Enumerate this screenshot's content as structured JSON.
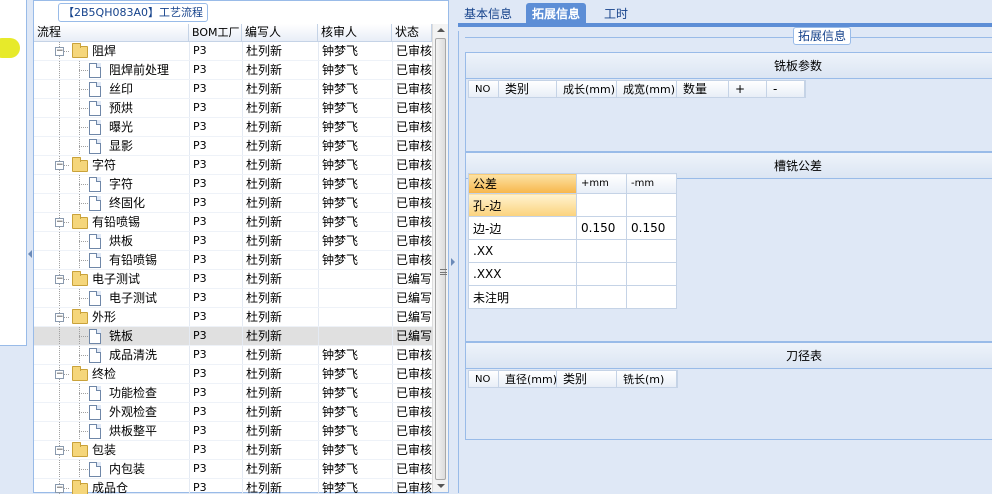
{
  "tree_panel": {
    "title": "【2B5QH083A0】工艺流程",
    "columns": [
      "流程",
      "BOM工厂",
      "编写人",
      "核审人",
      "状态"
    ],
    "rows": [
      {
        "level": 1,
        "type": "folder",
        "name": "阻焊",
        "bom": "P3",
        "writer": "杜列新",
        "reviewer": "钟梦飞",
        "status": "已审核"
      },
      {
        "level": 2,
        "type": "doc",
        "name": "阻焊前处理",
        "bom": "P3",
        "writer": "杜列新",
        "reviewer": "钟梦飞",
        "status": "已审核"
      },
      {
        "level": 2,
        "type": "doc",
        "name": "丝印",
        "bom": "P3",
        "writer": "杜列新",
        "reviewer": "钟梦飞",
        "status": "已审核"
      },
      {
        "level": 2,
        "type": "doc",
        "name": "预烘",
        "bom": "P3",
        "writer": "杜列新",
        "reviewer": "钟梦飞",
        "status": "已审核"
      },
      {
        "level": 2,
        "type": "doc",
        "name": "曝光",
        "bom": "P3",
        "writer": "杜列新",
        "reviewer": "钟梦飞",
        "status": "已审核"
      },
      {
        "level": 2,
        "type": "doc",
        "name": "显影",
        "bom": "P3",
        "writer": "杜列新",
        "reviewer": "钟梦飞",
        "status": "已审核"
      },
      {
        "level": 1,
        "type": "folder",
        "name": "字符",
        "bom": "P3",
        "writer": "杜列新",
        "reviewer": "钟梦飞",
        "status": "已审核"
      },
      {
        "level": 2,
        "type": "doc",
        "name": "字符",
        "bom": "P3",
        "writer": "杜列新",
        "reviewer": "钟梦飞",
        "status": "已审核"
      },
      {
        "level": 2,
        "type": "doc",
        "name": "终固化",
        "bom": "P3",
        "writer": "杜列新",
        "reviewer": "钟梦飞",
        "status": "已审核"
      },
      {
        "level": 1,
        "type": "folder",
        "name": "有铅喷锡",
        "bom": "P3",
        "writer": "杜列新",
        "reviewer": "钟梦飞",
        "status": "已审核"
      },
      {
        "level": 2,
        "type": "doc",
        "name": "烘板",
        "bom": "P3",
        "writer": "杜列新",
        "reviewer": "钟梦飞",
        "status": "已审核"
      },
      {
        "level": 2,
        "type": "doc",
        "name": "有铅喷锡",
        "bom": "P3",
        "writer": "杜列新",
        "reviewer": "钟梦飞",
        "status": "已审核"
      },
      {
        "level": 1,
        "type": "folder",
        "name": "电子测试",
        "bom": "P3",
        "writer": "杜列新",
        "reviewer": "",
        "status": "已编写"
      },
      {
        "level": 2,
        "type": "doc",
        "name": "电子测试",
        "bom": "P3",
        "writer": "杜列新",
        "reviewer": "",
        "status": "已编写"
      },
      {
        "level": 1,
        "type": "folder",
        "name": "外形",
        "bom": "P3",
        "writer": "杜列新",
        "reviewer": "",
        "status": "已编写"
      },
      {
        "level": 2,
        "type": "doc",
        "name": "铣板",
        "bom": "P3",
        "writer": "杜列新",
        "reviewer": "",
        "status": "已编写",
        "selected": true
      },
      {
        "level": 2,
        "type": "doc",
        "name": "成品清洗",
        "bom": "P3",
        "writer": "杜列新",
        "reviewer": "钟梦飞",
        "status": "已审核"
      },
      {
        "level": 1,
        "type": "folder",
        "name": "终检",
        "bom": "P3",
        "writer": "杜列新",
        "reviewer": "钟梦飞",
        "status": "已审核"
      },
      {
        "level": 2,
        "type": "doc",
        "name": "功能检查",
        "bom": "P3",
        "writer": "杜列新",
        "reviewer": "钟梦飞",
        "status": "已审核"
      },
      {
        "level": 2,
        "type": "doc",
        "name": "外观检查",
        "bom": "P3",
        "writer": "杜列新",
        "reviewer": "钟梦飞",
        "status": "已审核"
      },
      {
        "level": 2,
        "type": "doc",
        "name": "烘板整平",
        "bom": "P3",
        "writer": "杜列新",
        "reviewer": "钟梦飞",
        "status": "已审核"
      },
      {
        "level": 1,
        "type": "folder",
        "name": "包装",
        "bom": "P3",
        "writer": "杜列新",
        "reviewer": "钟梦飞",
        "status": "已审核"
      },
      {
        "level": 2,
        "type": "doc",
        "name": "内包装",
        "bom": "P3",
        "writer": "杜列新",
        "reviewer": "钟梦飞",
        "status": "已审核"
      },
      {
        "level": 1,
        "type": "folder",
        "name": "成品仓",
        "bom": "P3",
        "writer": "杜列新",
        "reviewer": "钟梦飞",
        "status": "已审核"
      }
    ]
  },
  "tabs": {
    "basic": "基本信息",
    "extended": "拓展信息",
    "worktime": "工时"
  },
  "extended_panel": {
    "title": "拓展信息",
    "milling_board": {
      "title": "铣板参数",
      "columns": [
        "NO",
        "类别",
        "成长(mm)",
        "成宽(mm)",
        "数量",
        "+",
        "-"
      ]
    },
    "slot_tolerance": {
      "title": "槽铣公差",
      "header": [
        "公差",
        "+mm",
        "-mm"
      ],
      "rows": [
        {
          "label": "孔-边",
          "plus": "",
          "minus": ""
        },
        {
          "label": "边-边",
          "plus": "0.150",
          "minus": "0.150"
        },
        {
          "label": ".XX",
          "plus": "",
          "minus": ""
        },
        {
          "label": ".XXX",
          "plus": "",
          "minus": ""
        },
        {
          "label": "未注明",
          "plus": "",
          "minus": ""
        }
      ]
    },
    "tool_diameter": {
      "title": "刀径表",
      "columns": [
        "NO",
        "直径(mm)",
        "类别",
        "铣长(m)"
      ]
    }
  }
}
